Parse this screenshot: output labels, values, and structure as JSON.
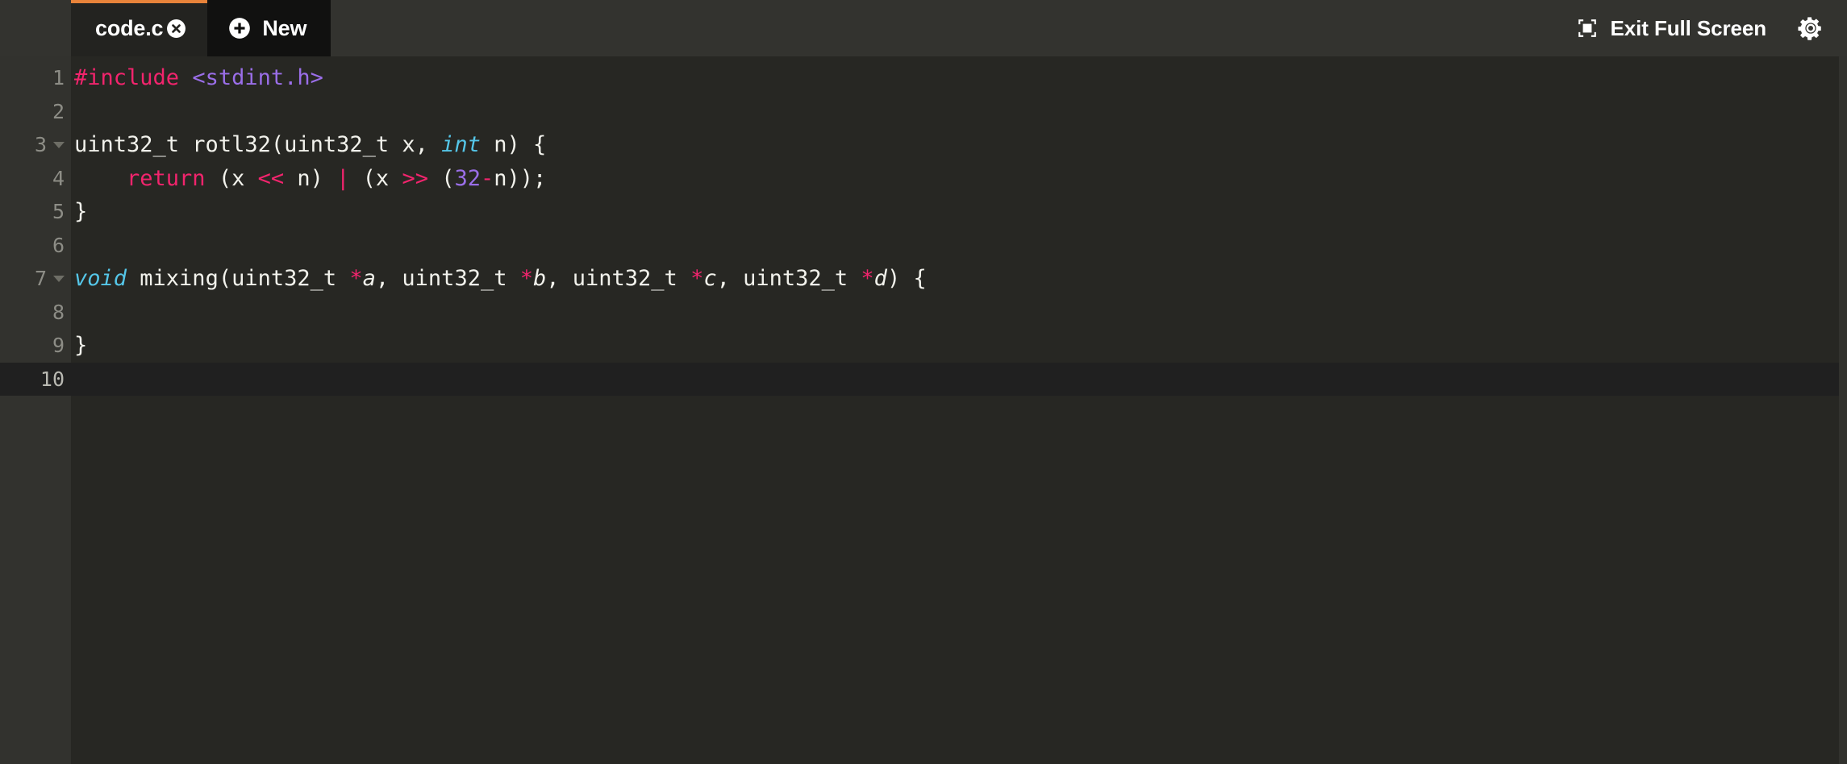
{
  "window": {
    "background_color": "#272723",
    "gutter_color": "#32322e",
    "accent_color": "#e8833a"
  },
  "topbar": {
    "tabs": [
      {
        "label": "code.c",
        "active": true,
        "close_icon": "close-circle-icon"
      },
      {
        "label": "New",
        "active": false,
        "add_icon": "plus-circle-icon"
      }
    ],
    "fullscreen": {
      "label": "Exit Full Screen",
      "icon": "fullscreen-exit-icon"
    },
    "settings": {
      "icon": "gear-icon"
    }
  },
  "editor": {
    "active_line": 10,
    "line_numbers": [
      "1",
      "2",
      "3",
      "4",
      "5",
      "6",
      "7",
      "8",
      "9",
      "10"
    ],
    "fold_lines": [
      3,
      7
    ],
    "lines": [
      {
        "n": "1",
        "tokens": [
          {
            "text": "#include",
            "type": "pre"
          },
          {
            "text": " ",
            "type": "plain"
          },
          {
            "text": "<stdint.h>",
            "type": "str"
          }
        ]
      },
      {
        "n": "2",
        "tokens": []
      },
      {
        "n": "3",
        "tokens": [
          {
            "text": "uint32_t rotl32(uint32_t x, ",
            "type": "plain"
          },
          {
            "text": "int",
            "type": "type"
          },
          {
            "text": " n) {",
            "type": "plain"
          }
        ]
      },
      {
        "n": "4",
        "tokens": [
          {
            "text": "    ",
            "type": "plain"
          },
          {
            "text": "return",
            "type": "kw"
          },
          {
            "text": " (x ",
            "type": "plain"
          },
          {
            "text": "<<",
            "type": "op"
          },
          {
            "text": " n) ",
            "type": "plain"
          },
          {
            "text": "|",
            "type": "op"
          },
          {
            "text": " (x ",
            "type": "plain"
          },
          {
            "text": ">>",
            "type": "op"
          },
          {
            "text": " (",
            "type": "plain"
          },
          {
            "text": "32",
            "type": "num"
          },
          {
            "text": "-",
            "type": "op"
          },
          {
            "text": "n));",
            "type": "plain"
          }
        ]
      },
      {
        "n": "5",
        "tokens": [
          {
            "text": "}",
            "type": "plain"
          }
        ]
      },
      {
        "n": "6",
        "tokens": []
      },
      {
        "n": "7",
        "tokens": [
          {
            "text": "void",
            "type": "type"
          },
          {
            "text": " mixing(uint32_t ",
            "type": "plain"
          },
          {
            "text": "*",
            "type": "op"
          },
          {
            "text": "a",
            "type": "param"
          },
          {
            "text": ", uint32_t ",
            "type": "plain"
          },
          {
            "text": "*",
            "type": "op"
          },
          {
            "text": "b",
            "type": "param"
          },
          {
            "text": ", uint32_t ",
            "type": "plain"
          },
          {
            "text": "*",
            "type": "op"
          },
          {
            "text": "c",
            "type": "param"
          },
          {
            "text": ", uint32_t ",
            "type": "plain"
          },
          {
            "text": "*",
            "type": "op"
          },
          {
            "text": "d",
            "type": "param"
          },
          {
            "text": ") {",
            "type": "plain"
          }
        ]
      },
      {
        "n": "8",
        "tokens": []
      },
      {
        "n": "9",
        "tokens": [
          {
            "text": "}",
            "type": "plain"
          }
        ]
      },
      {
        "n": "10",
        "tokens": []
      }
    ]
  }
}
